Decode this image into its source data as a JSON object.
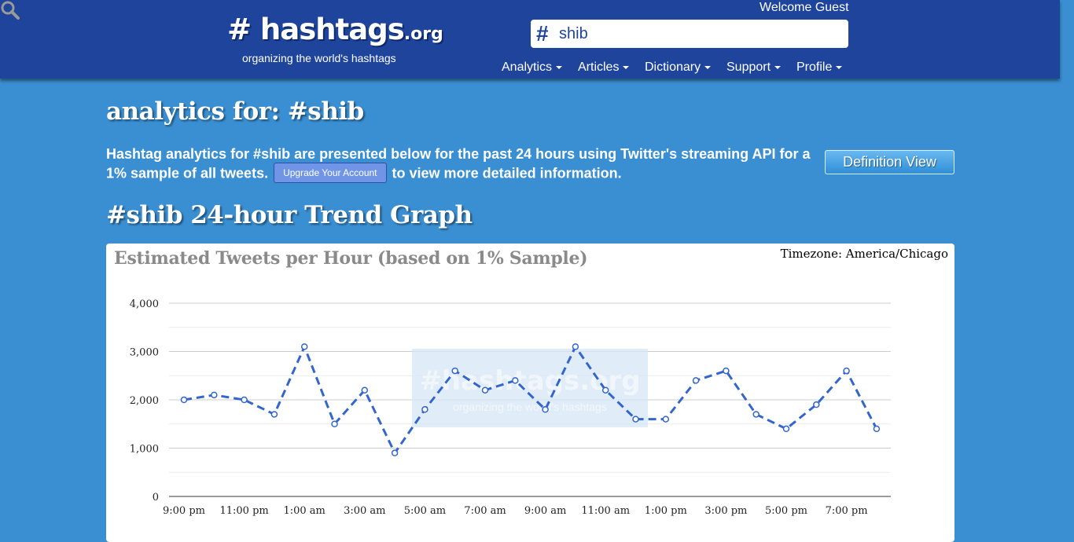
{
  "header": {
    "logo_text": "# hashtags",
    "logo_tld": ".org",
    "tagline": "organizing the world's hashtags",
    "welcome": "Welcome Guest",
    "search_value": "shib",
    "nav": [
      "Analytics",
      "Articles",
      "Dictionary",
      "Support",
      "Profile"
    ]
  },
  "page": {
    "title": "analytics for: #shib",
    "intro_before": "Hashtag analytics for #shib are presented below for the past 24 hours using Twitter's streaming API for a 1% sample of all tweets.",
    "upgrade_label": "Upgrade Your Account",
    "intro_after": "to view more detailed information.",
    "definition_button": "Definition View",
    "trend_title": "#shib 24-hour Trend Graph"
  },
  "chart": {
    "title": "Estimated Tweets per Hour (based on 1% Sample)",
    "timezone": "Timezone: America/Chicago",
    "watermark_main": "#hashtags.org",
    "watermark_tag": "organizing the world's hashtags"
  },
  "colors": {
    "header": "#1e449c",
    "background": "#3a8fd2",
    "line": "#3366cc"
  },
  "icons": {
    "search": "magnifier-icon",
    "hash": "hash-icon"
  },
  "chart_data": {
    "type": "line",
    "title": "Estimated Tweets per Hour (based on 1% Sample)",
    "xlabel": "",
    "ylabel": "",
    "ylim": [
      0,
      4000
    ],
    "y_ticks": [
      "0",
      "1,000",
      "2,000",
      "3,000",
      "4,000"
    ],
    "x_tick_labels": [
      "9:00 pm",
      "11:00 pm",
      "1:00 am",
      "3:00 am",
      "5:00 am",
      "7:00 am",
      "9:00 am",
      "11:00 am",
      "1:00 pm",
      "3:00 pm",
      "5:00 pm",
      "7:00 pm"
    ],
    "series": [
      {
        "values": [
          2000,
          2100,
          2000,
          1700,
          3100,
          1500,
          2200,
          900,
          1800,
          2600,
          2200,
          2400,
          1800,
          3100,
          2200,
          1600,
          1600,
          2400,
          2600,
          1700,
          1400,
          1900,
          2600,
          1400
        ]
      }
    ],
    "grid": true,
    "legend": "none"
  }
}
